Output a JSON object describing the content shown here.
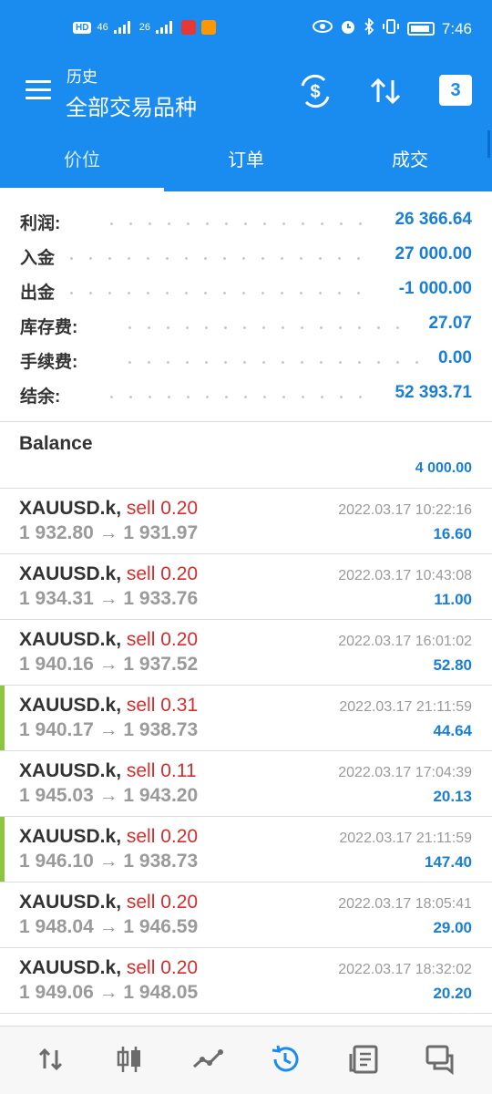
{
  "status_bar": {
    "time": "7:46",
    "hd_badge": "HD",
    "sim1_label": "46",
    "sim2_label": "26"
  },
  "header": {
    "subtitle": "历史",
    "title": "全部交易品种",
    "calendar_day": "3"
  },
  "tabs": [
    {
      "label": "价位",
      "active": true
    },
    {
      "label": "订单",
      "active": false
    },
    {
      "label": "成交",
      "active": false
    }
  ],
  "summary": [
    {
      "label": "利润:",
      "value": "26 366.64"
    },
    {
      "label": "入金",
      "value": "27 000.00"
    },
    {
      "label": "出金",
      "value": "-1 000.00"
    },
    {
      "label": "库存费:",
      "value": "27.07"
    },
    {
      "label": "手续费:",
      "value": "0.00"
    },
    {
      "label": "结余:",
      "value": "52 393.71"
    }
  ],
  "balance": {
    "label": "Balance",
    "value": "4 000.00"
  },
  "trades": [
    {
      "symbol": "XAUUSD.k,",
      "side": "sell 0.20",
      "prices": "1 932.80 → 1 931.97",
      "datetime": "2022.03.17 10:22:16",
      "profit": "16.60",
      "marked": false
    },
    {
      "symbol": "XAUUSD.k,",
      "side": "sell 0.20",
      "prices": "1 934.31 → 1 933.76",
      "datetime": "2022.03.17 10:43:08",
      "profit": "11.00",
      "marked": false
    },
    {
      "symbol": "XAUUSD.k,",
      "side": "sell 0.20",
      "prices": "1 940.16 → 1 937.52",
      "datetime": "2022.03.17 16:01:02",
      "profit": "52.80",
      "marked": false
    },
    {
      "symbol": "XAUUSD.k,",
      "side": "sell 0.31",
      "prices": "1 940.17 → 1 938.73",
      "datetime": "2022.03.17 21:11:59",
      "profit": "44.64",
      "marked": true
    },
    {
      "symbol": "XAUUSD.k,",
      "side": "sell 0.11",
      "prices": "1 945.03 → 1 943.20",
      "datetime": "2022.03.17 17:04:39",
      "profit": "20.13",
      "marked": false
    },
    {
      "symbol": "XAUUSD.k,",
      "side": "sell 0.20",
      "prices": "1 946.10 → 1 938.73",
      "datetime": "2022.03.17 21:11:59",
      "profit": "147.40",
      "marked": true
    },
    {
      "symbol": "XAUUSD.k,",
      "side": "sell 0.20",
      "prices": "1 948.04 → 1 946.59",
      "datetime": "2022.03.17 18:05:41",
      "profit": "29.00",
      "marked": false
    },
    {
      "symbol": "XAUUSD.k,",
      "side": "sell 0.20",
      "prices": "1 949.06 → 1 948.05",
      "datetime": "2022.03.17 18:32:02",
      "profit": "20.20",
      "marked": false
    }
  ],
  "bottom_nav": [
    {
      "name": "quotes-icon",
      "active": false
    },
    {
      "name": "chart-icon",
      "active": false
    },
    {
      "name": "trade-icon",
      "active": false
    },
    {
      "name": "history-icon",
      "active": true
    },
    {
      "name": "news-icon",
      "active": false
    },
    {
      "name": "chat-icon",
      "active": false
    }
  ],
  "colors": {
    "primary": "#1a8cf0",
    "profit": "#1a7fd4",
    "sell": "#d32f2f",
    "marker": "#8cc63f"
  }
}
